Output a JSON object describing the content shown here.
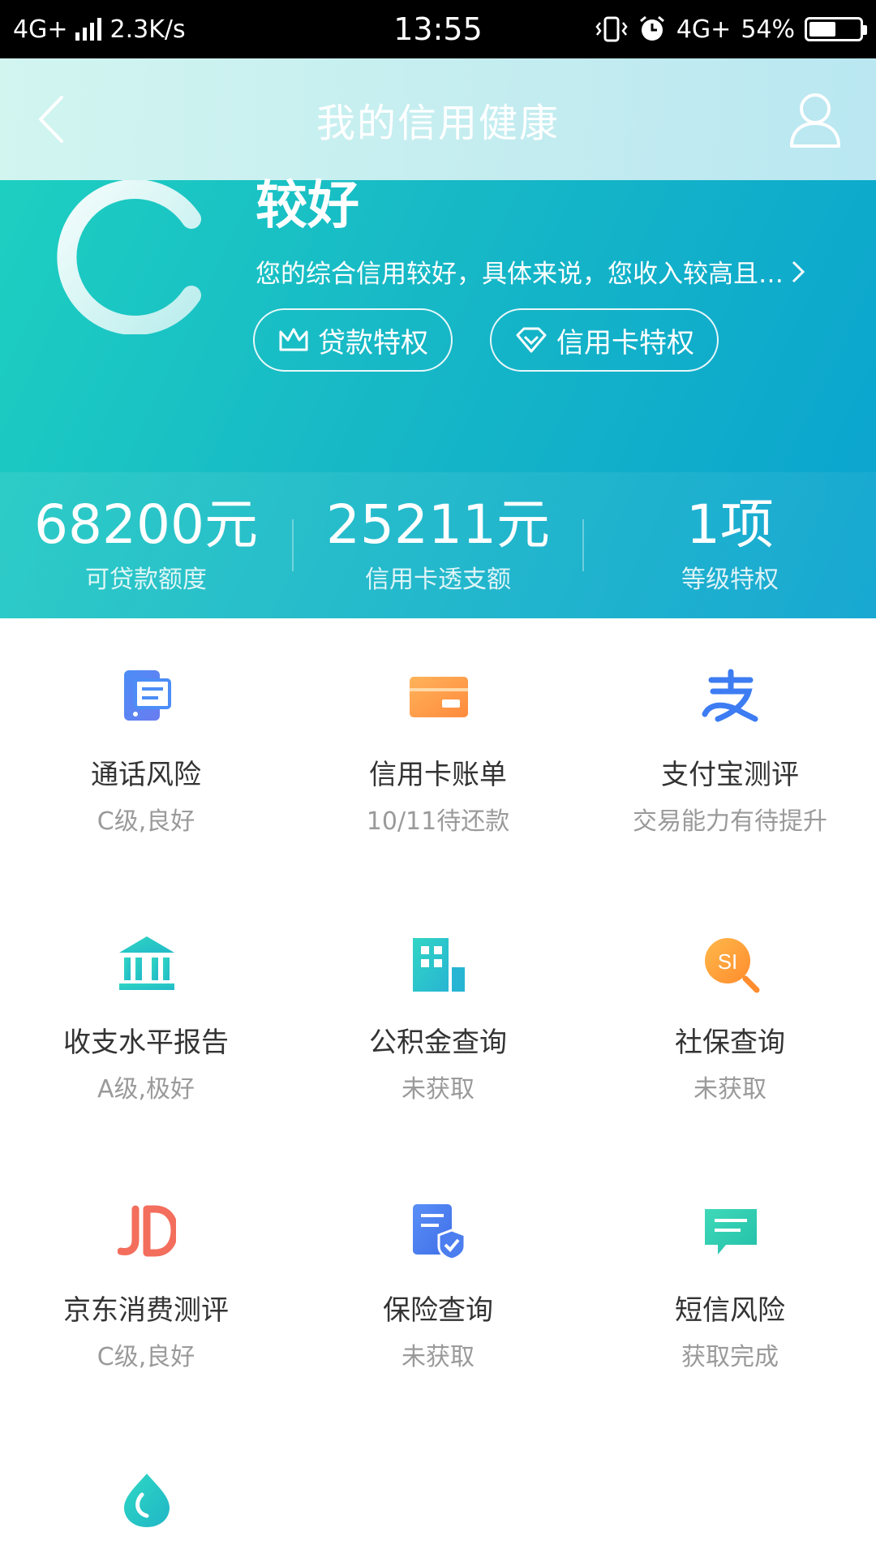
{
  "status_bar": {
    "network": "4G+",
    "speed": "2.3K/s",
    "time": "13:55",
    "network2": "4G+",
    "battery": "54%",
    "battery_level": 0.54
  },
  "nav": {
    "title": "我的信用健康",
    "back_icon": "chevron-left-icon",
    "user_icon": "user-icon"
  },
  "hero": {
    "grade_letter_icon": "c-grade-ring-icon",
    "grade_title": "较好",
    "description": "您的综合信用较好，具体来说，您收入较高且…",
    "pills": [
      {
        "label": "贷款特权",
        "icon": "crown-icon"
      },
      {
        "label": "信用卡特权",
        "icon": "diamond-icon"
      }
    ]
  },
  "stats": [
    {
      "value": "68200元",
      "label": "可贷款额度"
    },
    {
      "value": "25211元",
      "label": "信用卡透支额"
    },
    {
      "value": "1项",
      "label": "等级特权"
    }
  ],
  "grid": [
    {
      "title": "通话风险",
      "subtitle": "C级,良好",
      "icon": "phone-risk-icon"
    },
    {
      "title": "信用卡账单",
      "subtitle": "10/11待还款",
      "icon": "credit-card-icon"
    },
    {
      "title": "支付宝测评",
      "subtitle": "交易能力有待提升",
      "icon": "alipay-icon"
    },
    {
      "title": "收支水平报告",
      "subtitle": "A级,极好",
      "icon": "bank-icon"
    },
    {
      "title": "公积金查询",
      "subtitle": "未获取",
      "icon": "building-icon"
    },
    {
      "title": "社保查询",
      "subtitle": "未获取",
      "icon": "social-security-icon"
    },
    {
      "title": "京东消费测评",
      "subtitle": "C级,良好",
      "icon": "jd-icon"
    },
    {
      "title": "保险查询",
      "subtitle": "未获取",
      "icon": "insurance-icon"
    },
    {
      "title": "短信风险",
      "subtitle": "获取完成",
      "icon": "sms-icon"
    }
  ],
  "colors": {
    "gradient_start": "#1ed2c0",
    "gradient_end": "#0aa3cf",
    "text_primary": "#333333",
    "text_secondary": "#9a9a9a"
  }
}
